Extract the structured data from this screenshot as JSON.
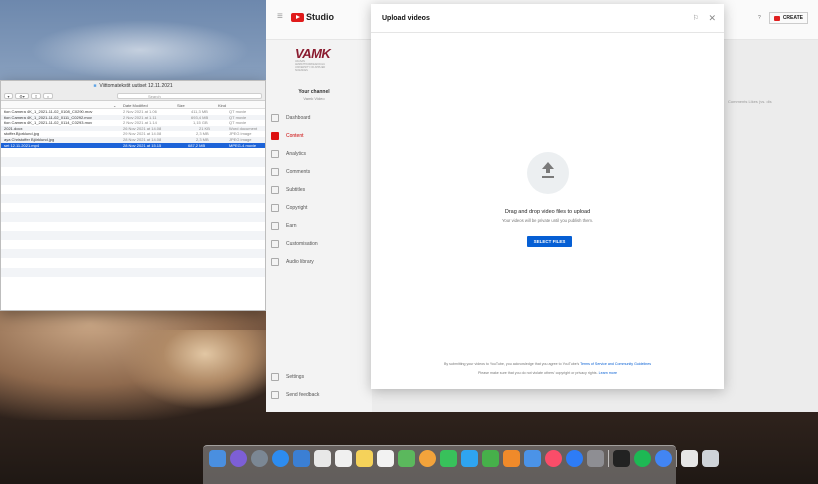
{
  "finder": {
    "title": "Viittomatekstit uutiset 12.11.2021",
    "search_placeholder": "Search",
    "columns": {
      "date": "Date Modified",
      "size": "Size",
      "kind": "Kind"
    },
    "rows": [
      {
        "name": "tion Camera 4K_1_2021-11-02_0108_C0290.mov",
        "date": "2 Nov 2021 at 1.06",
        "size": "411,3 MB",
        "kind": "QT movie"
      },
      {
        "name": "tion Camera 4K_1_2021-11-02_0111_C0292.mov",
        "date": "2 Nov 2021 at 1.11",
        "size": "693,4 MB",
        "kind": "QT movie"
      },
      {
        "name": "tion Camera 4K_1_2021-11-02_0114_C0293.mov",
        "date": "2 Nov 2021 at 1.14",
        "size": "1,15 GB",
        "kind": "QT movie"
      },
      {
        "name": "2021.docx",
        "date": "26 Nov 2021 at 14.08",
        "size": "21 KB",
        "kind": "Word document"
      },
      {
        "name": "stoffer.Bjorklund.jpg",
        "date": "29 Nov 2021 at 14.08",
        "size": "2,3 MB",
        "kind": "JPEG image"
      },
      {
        "name": "aya Christoffer Björklund.jpg",
        "date": "28 Nov 2021 at 14.08",
        "size": "2,3 MB",
        "kind": "JPEG image"
      },
      {
        "name": "set 12.11.2021.mp4",
        "date": "28 Nov 2021 at 15.15",
        "size": "687,2 MB",
        "kind": "MPEG-4 movie"
      }
    ]
  },
  "studio": {
    "logo_text": "Studio",
    "org_logo": "VAMK",
    "org_sub": "VAASAN AMMATTIKORKEAKOULU UNIVERSITY OF APPLIED SCIENCES",
    "your_channel": "Your channel",
    "channel_name": "Vamk Video",
    "nav": [
      {
        "label": "Dashboard"
      },
      {
        "label": "Content"
      },
      {
        "label": "Analytics"
      },
      {
        "label": "Comments"
      },
      {
        "label": "Subtitles"
      },
      {
        "label": "Copyright"
      },
      {
        "label": "Earn"
      },
      {
        "label": "Customisation"
      },
      {
        "label": "Audio library"
      }
    ],
    "settings": "Settings",
    "feedback": "Send feedback",
    "create": "CREATE",
    "bg_columns": "Comments    Likes (vs. dis"
  },
  "upload": {
    "title": "Upload videos",
    "drag_text": "Drag and drop video files to upload",
    "private_text": "Your videos will be private until you publish them.",
    "select_button": "SELECT FILES",
    "terms_line1": "By submitting your videos to YouTube, you acknowledge that you agree to YouTube's",
    "terms_link": "Terms of Service and Community Guidelines",
    "terms_line2": "Please make sure that you do not violate others' copyright or privacy rights.",
    "learn_more": "Learn more"
  },
  "colors": {
    "accent": "#065fd4",
    "brand_red": "#e01b1b",
    "selection": "#1d63d8"
  }
}
